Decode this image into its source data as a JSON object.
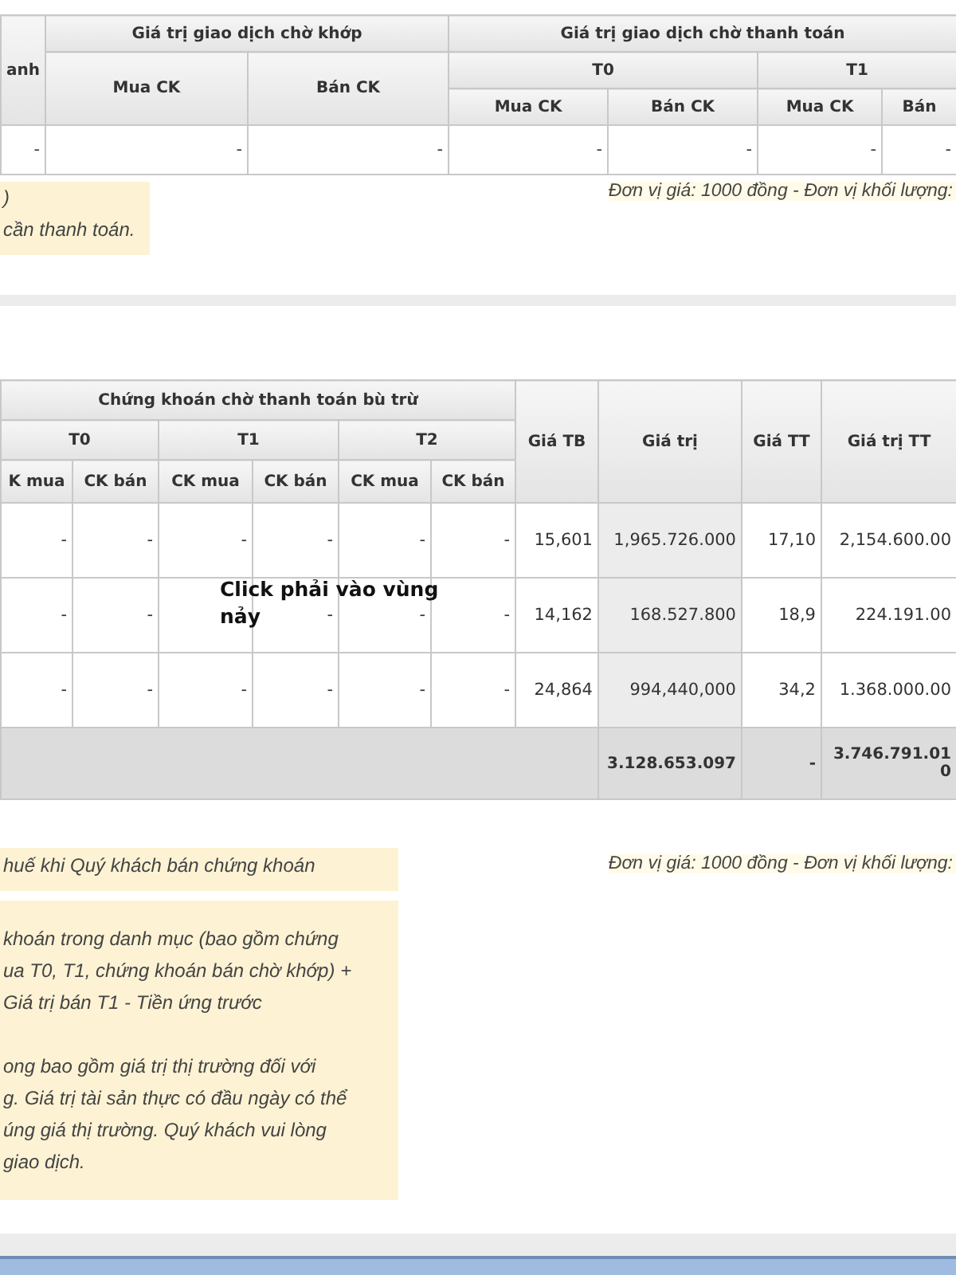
{
  "top_table": {
    "first_header": "anh",
    "pending_match": {
      "label": "Giá trị giao dịch chờ khớp",
      "columns": [
        "Mua CK",
        "Bán CK"
      ]
    },
    "pending_settle": {
      "label": "Giá trị giao dịch chờ thanh toán",
      "groups": [
        {
          "label": "T0",
          "columns": [
            "Mua CK",
            "Bán CK"
          ]
        },
        {
          "label": "T1",
          "columns": [
            "Mua CK",
            "Bán"
          ]
        }
      ]
    },
    "rows": [
      [
        "-",
        "-",
        "-",
        "-",
        "-",
        "-",
        "-"
      ]
    ]
  },
  "top_notes": {
    "lines": [
      ")",
      "cần thanh toán."
    ],
    "unit": "Đơn vị giá: 1000 đồng - Đơn vị khối lượng:"
  },
  "bottom_table": {
    "group": "Chứng khoán chờ thanh toán bù trừ",
    "subgroups": [
      {
        "label": "T0",
        "columns": [
          "K mua",
          "CK bán"
        ]
      },
      {
        "label": "T1",
        "columns": [
          "CK mua",
          "CK bán"
        ]
      },
      {
        "label": "T2",
        "columns": [
          "CK mua",
          "CK bán"
        ]
      }
    ],
    "value_headers": [
      "Giá TB",
      "Giá trị",
      "Giá TT",
      "Giá trị TT"
    ],
    "rows": [
      [
        "-",
        "-",
        "-",
        "-",
        "-",
        "-",
        "15,601",
        "1,965.726.000",
        "17,10",
        "2,154.600.00"
      ],
      [
        "-",
        "-",
        "",
        "-",
        "-",
        "-",
        "14,162",
        "168.527.800",
        "18,9",
        "224.191.00"
      ],
      [
        "-",
        "-",
        "-",
        "-",
        "-",
        "-",
        "24,864",
        "994,440,000",
        "34,2",
        "1.368.000.00"
      ]
    ],
    "total": [
      "3.128.653.097",
      "-",
      "3.746.791.010"
    ]
  },
  "annotation": [
    "Click phải vào vùng",
    "nảy"
  ],
  "bottom_notes": {
    "tax_line": "huế khi Quý khách bán chứng khoán",
    "paragraphs": [
      [
        "khoán trong danh mục (bao gồm chứng",
        "ua T0, T1, chứng khoán bán chờ khớp) +",
        "Giá trị bán T1 - Tiền ứng trước"
      ],
      [
        "ong bao gồm giá trị thị trường đối với",
        "g. Giá trị tài sản thực có đầu ngày có thể",
        "úng giá thị trường. Quý khách vui lòng",
        "giao dịch."
      ]
    ],
    "unit": "Đơn vị giá: 1000 đồng - Đơn vị khối lượng:"
  }
}
